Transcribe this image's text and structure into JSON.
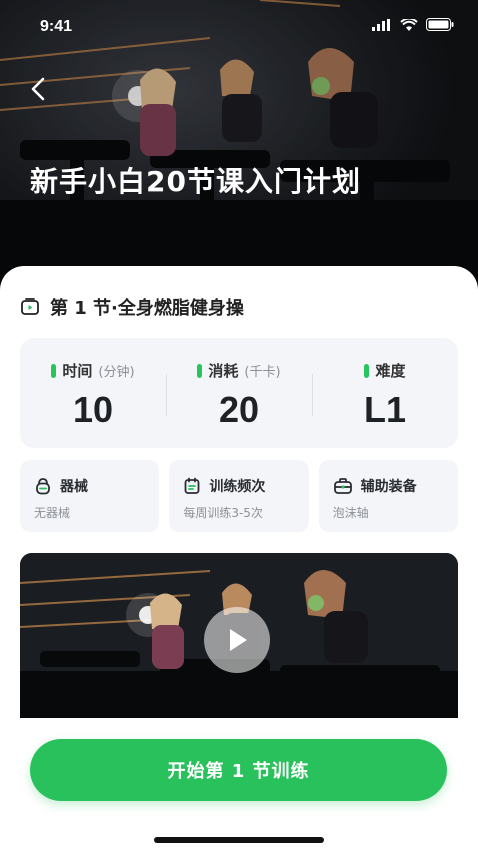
{
  "status_bar": {
    "time": "9:41"
  },
  "hero": {
    "title": "新手小白20节课入门计划"
  },
  "lesson": {
    "title": "第 1 节·全身燃脂健身操"
  },
  "stats": [
    {
      "label": "时间",
      "unit": "(分钟)",
      "value": "10"
    },
    {
      "label": "消耗",
      "unit": "(千卡)",
      "value": "20"
    },
    {
      "label": "难度",
      "unit": "",
      "value": "L1"
    }
  ],
  "info_cards": [
    {
      "icon": "kettlebell-icon",
      "title": "器械",
      "subtitle": "无器械"
    },
    {
      "icon": "calendar-icon",
      "title": "训练频次",
      "subtitle": "每周训练3-5次"
    },
    {
      "icon": "equipment-bag-icon",
      "title": "辅助装备",
      "subtitle": "泡沫轴"
    }
  ],
  "cta": {
    "label": "开始第 1 节训练"
  },
  "colors": {
    "accent": "#29c15c",
    "card_bg": "#f4f5f8"
  }
}
